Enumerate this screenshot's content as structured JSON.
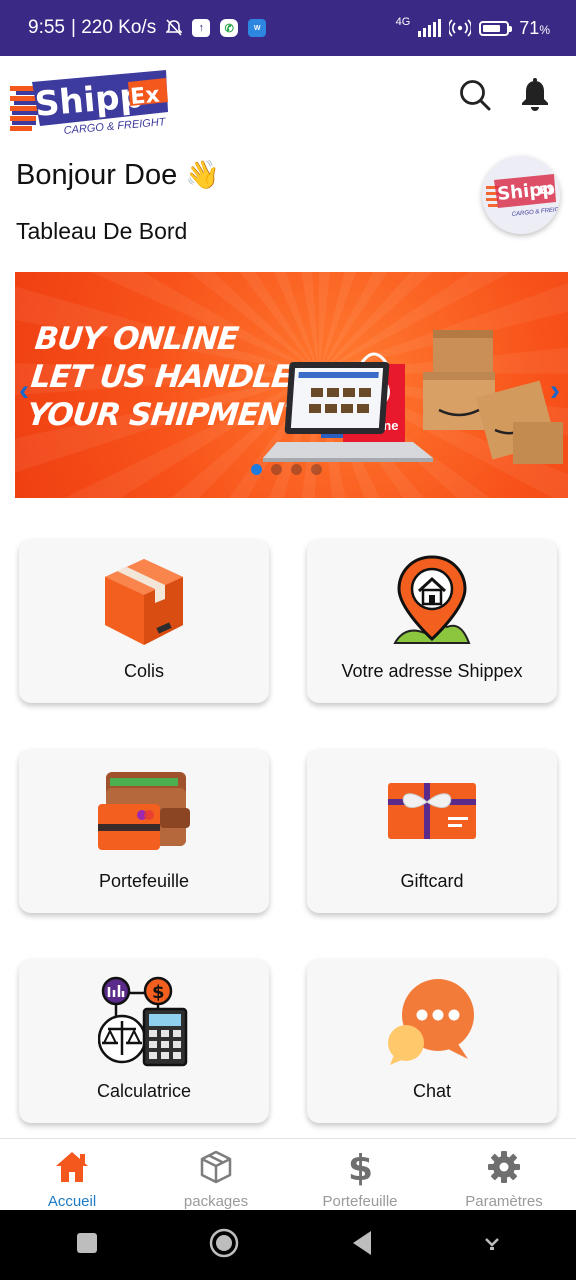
{
  "status_bar": {
    "time": "9:55",
    "speed": "| 220 Ko/s",
    "network": "4G",
    "battery": "71",
    "battery_unit": "%"
  },
  "header": {
    "logo_text": "ShippEx",
    "logo_tagline": "CARGO & FREIGHT",
    "search_icon": "search-icon",
    "notification_icon": "bell-icon"
  },
  "greeting": {
    "text": "Bonjour Doe",
    "emoji": "👋",
    "subtitle": "Tableau De Bord"
  },
  "banner": {
    "lines": [
      "BUY ONLINE",
      "LET US HANDLE",
      "YOUR SHIPMENT"
    ],
    "sign_text": "Online",
    "left_arrow": "‹",
    "right_arrow": "›",
    "active_slide": 1,
    "slide_count": 4,
    "colors": {
      "background": "#f8531a",
      "indicator_active": "#1e7be0"
    }
  },
  "tiles": [
    {
      "label": "Colis",
      "icon": "package-box-icon"
    },
    {
      "label": "Votre adresse Shippex",
      "icon": "home-location-pin-icon"
    },
    {
      "label": "Portefeuille",
      "icon": "wallet-icon"
    },
    {
      "label": "Giftcard",
      "icon": "gift-card-icon"
    },
    {
      "label": "Calculatrice",
      "icon": "calculator-scale-icon"
    },
    {
      "label": "Chat",
      "icon": "chat-bubble-icon"
    }
  ],
  "bottom_nav": [
    {
      "label": "Accueil",
      "icon": "home-icon",
      "active": true
    },
    {
      "label": "packages",
      "icon": "cube-icon",
      "active": false
    },
    {
      "label": "Portefeuille",
      "icon": "dollar-icon",
      "active": false
    },
    {
      "label": "Paramètres",
      "icon": "gear-icon",
      "active": false
    }
  ],
  "colors": {
    "status_bar": "#3a2a86",
    "brand_orange": "#f5581c",
    "brand_blue": "#3d3b9e",
    "nav_active": "#1e7bc4",
    "nav_inactive": "#9a9a9a"
  }
}
